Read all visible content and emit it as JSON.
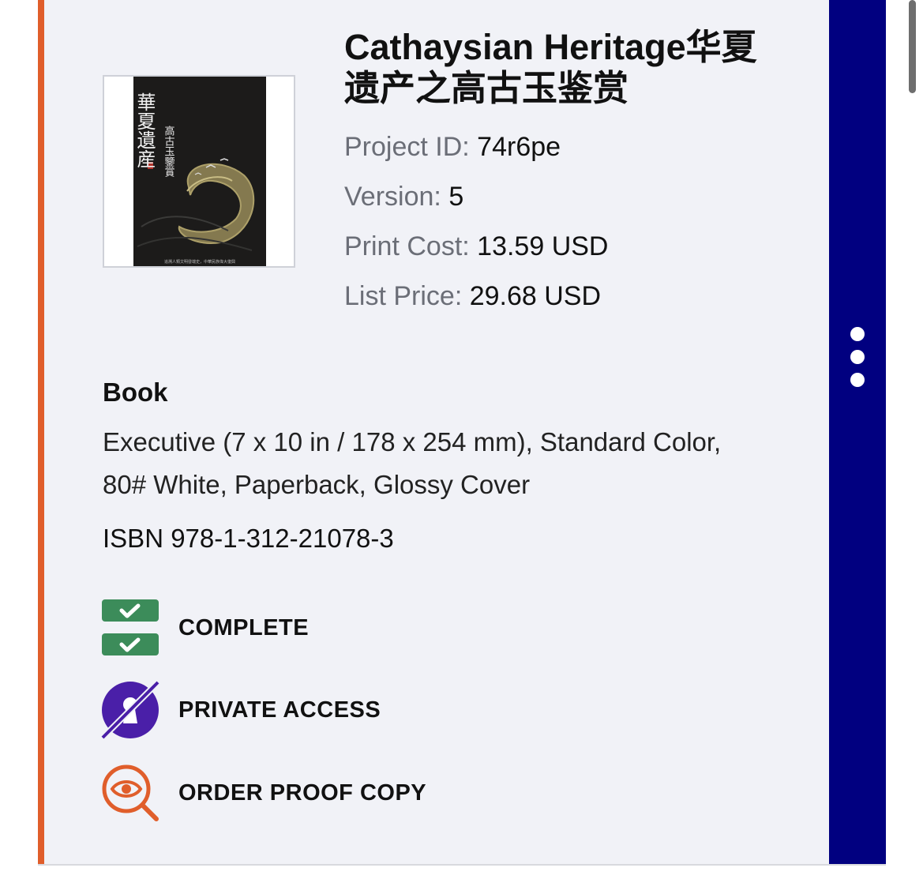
{
  "project": {
    "title": "Cathaysian Heritage华夏遗产之高古玉鉴赏",
    "project_id_label": "Project ID:",
    "project_id": "74r6pe",
    "version_label": "Version:",
    "version": "5",
    "print_cost_label": "Print Cost:",
    "print_cost": "13.59 USD",
    "list_price_label": "List Price:",
    "list_price": "29.68 USD"
  },
  "book": {
    "heading": "Book",
    "spec": "Executive (7 x 10 in / 178 x 254 mm), Standard Color, 80# White, Paperback, Glossy Cover",
    "isbn": "ISBN 978-1-312-21078-3"
  },
  "cover": {
    "calligraphy_large": "華夏遺産",
    "calligraphy_small": "高古玉鑒賞",
    "footer": "追溯人類文明發端史，中華民族偉大復興"
  },
  "statuses": [
    {
      "label": "COMPLETE",
      "icon": "double-check-icon",
      "color": "#3c8c5a"
    },
    {
      "label": "PRIVATE ACCESS",
      "icon": "eye-slash-icon",
      "color": "#4a1fa8"
    },
    {
      "label": "ORDER PROOF COPY",
      "icon": "eye-magnifier-icon",
      "color": "#e05e2b"
    }
  ],
  "colors": {
    "accent": "#e05e2b",
    "side_panel": "#010080",
    "card_bg": "#f1f2f7"
  }
}
